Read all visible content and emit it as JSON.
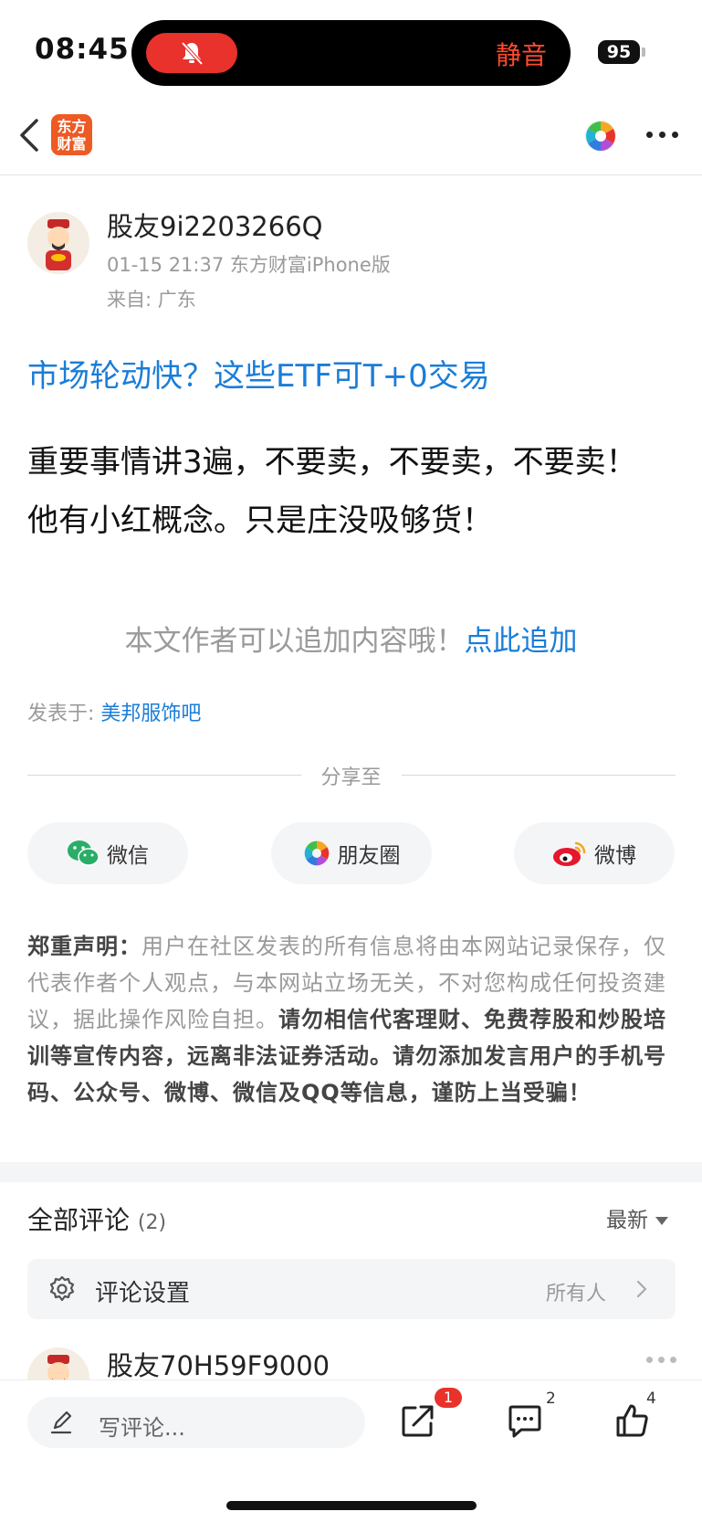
{
  "status_bar": {
    "time": "08:45",
    "mute_label": "静音",
    "battery": "95"
  },
  "header": {
    "logo_line1": "东方",
    "logo_line2": "财富"
  },
  "post": {
    "author_name": "股友9i2203266Q",
    "meta": "01-15 21:37 东方财富iPhone版",
    "location": "来自: 广东",
    "link_title": "市场轮动快？这些ETF可T+0交易",
    "body_line1": "重要事情讲3遍，不要卖，不要卖，不要卖！",
    "body_line2": "他有小红概念。只是庄没吸够货！",
    "append_hint": "本文作者可以追加内容哦！",
    "append_link": "点此追加",
    "forum_prefix": "发表于: ",
    "forum_name": "美邦服饰吧"
  },
  "share": {
    "label": "分享至",
    "wechat": "微信",
    "moments": "朋友圈",
    "weibo": "微博"
  },
  "disclaimer": {
    "title": "郑重声明：",
    "plain": "用户在社区发表的所有信息将由本网站记录保存，仅代表作者个人观点，与本网站立场无关，不对您构成任何投资建议，据此操作风险自担。",
    "bold": "请勿相信代客理财、免费荐股和炒股培训等宣传内容，远离非法证券活动。请勿添加发言用户的手机号码、公众号、微博、微信及QQ等信息，谨防上当受骗！"
  },
  "comments": {
    "title": "全部评论",
    "count": "(2)",
    "sort": "最新",
    "settings_label": "评论设置",
    "settings_value": "所有人",
    "first_author": "股友70H59F9000"
  },
  "bottom_bar": {
    "input_placeholder": "写评论...",
    "share_badge": "1",
    "comment_count": "2",
    "like_count": "4"
  },
  "colors": {
    "accent_blue": "#1a7dd8",
    "brand_orange": "#ee5a24",
    "badge_red": "#e8322b"
  }
}
